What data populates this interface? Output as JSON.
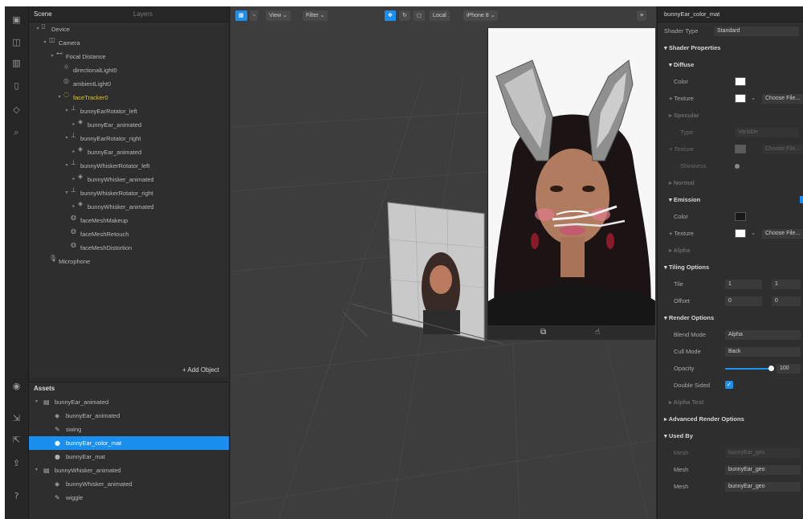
{
  "scene_panel": {
    "tabs": [
      "Scene",
      "Layers"
    ],
    "tree": [
      {
        "label": "Device",
        "depth": 0,
        "icon": "device-icon",
        "arrow": "▾"
      },
      {
        "label": "Camera",
        "depth": 1,
        "icon": "camera-icon",
        "arrow": "▾"
      },
      {
        "label": "Focal Distance",
        "depth": 2,
        "icon": "focal-distance-icon",
        "arrow": "▾"
      },
      {
        "label": "directionalLight0",
        "depth": 3,
        "icon": "light-icon",
        "arrow": ""
      },
      {
        "label": "ambientLight0",
        "depth": 3,
        "icon": "ambient-light-icon",
        "arrow": ""
      },
      {
        "label": "faceTracker0",
        "depth": 3,
        "icon": "face-tracker-icon",
        "arrow": "▾",
        "highlight": true
      },
      {
        "label": "bunnyEarRotator_left",
        "depth": 4,
        "icon": "rotator-icon",
        "arrow": "▾"
      },
      {
        "label": "bunnyEar_animated",
        "depth": 5,
        "icon": "mesh-icon",
        "arrow": "▸"
      },
      {
        "label": "bunnyEarRotator_right",
        "depth": 4,
        "icon": "rotator-icon",
        "arrow": "▾"
      },
      {
        "label": "bunnyEar_animated",
        "depth": 5,
        "icon": "mesh-icon",
        "arrow": "▸"
      },
      {
        "label": "bunnyWhiskerRotator_left",
        "depth": 4,
        "icon": "rotator-icon",
        "arrow": "▾"
      },
      {
        "label": "bunnyWhisker_animated",
        "depth": 5,
        "icon": "mesh-icon",
        "arrow": "▸"
      },
      {
        "label": "bunnyWhiskerRotator_right",
        "depth": 4,
        "icon": "rotator-icon",
        "arrow": "▾"
      },
      {
        "label": "bunnyWhisker_animated",
        "depth": 5,
        "icon": "mesh-icon",
        "arrow": "▸"
      },
      {
        "label": "faceMeshMakeup",
        "depth": 4,
        "icon": "face-mesh-icon",
        "arrow": ""
      },
      {
        "label": "faceMeshRetouch",
        "depth": 4,
        "icon": "face-mesh-icon",
        "arrow": ""
      },
      {
        "label": "faceMeshDistortion",
        "depth": 4,
        "icon": "face-mesh-icon",
        "arrow": ""
      },
      {
        "label": "Microphone",
        "depth": 1,
        "icon": "microphone-icon",
        "arrow": ""
      }
    ],
    "add_object": "+ Add Object"
  },
  "assets_panel": {
    "title": "Assets",
    "items": [
      {
        "label": "bunnyEar_animated",
        "depth": 0,
        "arrow": "▾",
        "icon": "file-icon"
      },
      {
        "label": "bunnyEar_animated",
        "depth": 1,
        "arrow": "",
        "icon": "mesh-icon"
      },
      {
        "label": "swing",
        "depth": 1,
        "arrow": "",
        "icon": "animation-icon"
      },
      {
        "label": "bunnyEar_color_mat",
        "depth": 1,
        "arrow": "",
        "icon": "material-icon",
        "selected": true
      },
      {
        "label": "bunnyEar_mat",
        "depth": 1,
        "arrow": "",
        "icon": "material-icon"
      },
      {
        "label": "bunnyWhisker_animated",
        "depth": 0,
        "arrow": "▾",
        "icon": "file-icon"
      },
      {
        "label": "bunnyWhisker_animated",
        "depth": 1,
        "arrow": "",
        "icon": "mesh-icon"
      },
      {
        "label": "wiggle",
        "depth": 1,
        "arrow": "",
        "icon": "animation-icon"
      }
    ]
  },
  "viewport": {
    "toolbar": {
      "view": "View ⌄",
      "filter": "Filter ⌄",
      "local": "Local",
      "device": "iPhone 8 ⌄"
    }
  },
  "inspector": {
    "title": "bunnyEar_color_mat",
    "shader_type_label": "Shader Type",
    "shader_type_value": "Standard",
    "shader_properties": "Shader Properties",
    "diffuse": "Diffuse",
    "color": "Color",
    "texture": "Texture",
    "choose_file": "Choose File...",
    "specular": "Specular",
    "type": "Type",
    "type_value": "Variable",
    "shininess": "Shininess",
    "normal": "Normal",
    "emission": "Emission",
    "alpha": "Alpha",
    "tiling_options": "Tiling Options",
    "tile": "Tile",
    "tile_x": "1",
    "tile_y": "1",
    "offset": "Offset",
    "offset_x": "0",
    "offset_y": "0",
    "render_options": "Render Options",
    "blend_mode": "Blend Mode",
    "blend_mode_value": "Alpha",
    "cull_mode": "Cull Mode",
    "cull_mode_value": "Back",
    "opacity": "Opacity",
    "opacity_value": "100",
    "double_sided": "Double Sided",
    "alpha_test": "Alpha Test",
    "advanced_render_options": "Advanced Render Options",
    "used_by": "Used By",
    "mesh": "Mesh",
    "used_by_items": [
      "bunnyEar_geo",
      "bunnyEar_geo",
      "bunnyEar_geo"
    ]
  },
  "colors": {
    "accent": "#1a8ff0",
    "highlight": "#e2c23a",
    "panel": "#2e2e2e",
    "viewport": "#3d3d3d"
  }
}
